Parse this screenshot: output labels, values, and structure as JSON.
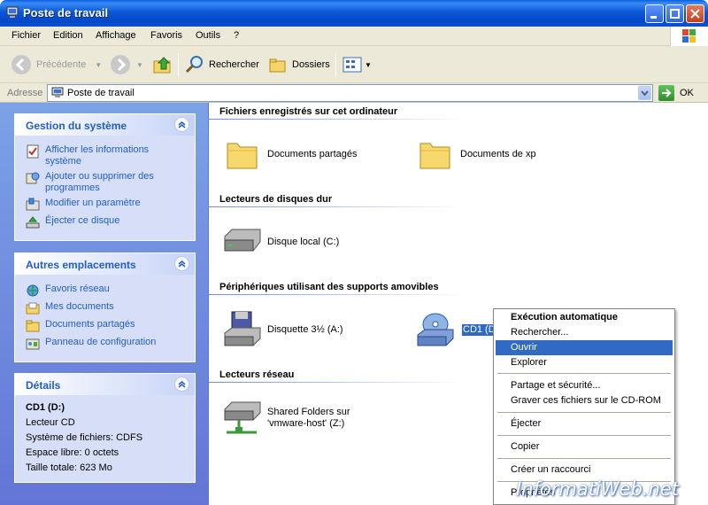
{
  "window": {
    "title": "Poste de travail"
  },
  "menu": [
    "Fichier",
    "Edition",
    "Affichage",
    "Favoris",
    "Outils",
    "?"
  ],
  "toolbar": {
    "back": "Précédente",
    "search": "Rechercher",
    "folders": "Dossiers"
  },
  "address": {
    "label": "Adresse",
    "value": "Poste de travail",
    "go": "OK"
  },
  "sidebar": {
    "system": {
      "title": "Gestion du système",
      "tasks": [
        {
          "label": "Afficher les informations système",
          "icon": "system-info-icon"
        },
        {
          "label": "Ajouter ou supprimer des programmes",
          "icon": "add-remove-programs-icon"
        },
        {
          "label": "Modifier un paramètre",
          "icon": "control-settings-icon"
        },
        {
          "label": "Éjecter ce disque",
          "icon": "eject-disk-icon"
        }
      ]
    },
    "places": {
      "title": "Autres emplacements",
      "items": [
        {
          "label": "Favoris réseau",
          "icon": "network-places-icon"
        },
        {
          "label": "Mes documents",
          "icon": "my-documents-icon"
        },
        {
          "label": "Documents partagés",
          "icon": "shared-folder-icon"
        },
        {
          "label": "Panneau de configuration",
          "icon": "control-panel-icon"
        }
      ]
    },
    "details": {
      "title": "Détails",
      "name": "CD1 (D:)",
      "type": "Lecteur CD",
      "filesystem": "Système de fichiers: CDFS",
      "free": "Espace libre: 0 octets",
      "total": "Taille totale: 623 Mo"
    }
  },
  "groups": [
    {
      "title": "Fichiers enregistrés sur cet ordinateur",
      "items": [
        {
          "label": "Documents partagés",
          "icon": "folder-icon"
        },
        {
          "label": "Documents de xp",
          "icon": "folder-icon"
        }
      ]
    },
    {
      "title": "Lecteurs de disques dur",
      "items": [
        {
          "label": "Disque local (C:)",
          "icon": "hard-disk-icon"
        }
      ]
    },
    {
      "title": "Périphériques utilisant des supports amovibles",
      "items": [
        {
          "label": "Disquette 3½ (A:)",
          "icon": "floppy-drive-icon"
        },
        {
          "label": "CD1 (D",
          "icon": "cd-drive-icon"
        }
      ]
    },
    {
      "title": "Lecteurs réseau",
      "items": [
        {
          "label_lines": [
            "Shared Folders sur",
            "'vmware-host' (Z:)"
          ],
          "icon": "network-drive-icon"
        }
      ]
    }
  ],
  "context_menu": {
    "items": [
      "Exécution automatique",
      "Rechercher...",
      "Ouvrir",
      "Explorer",
      "Partage et sécurité...",
      "Graver ces fichiers sur le CD-ROM",
      "Éjecter",
      "Copier",
      "Créer un raccourci",
      "Propriétés"
    ],
    "highlighted": "Ouvrir"
  },
  "watermark": "InformatiWeb.net",
  "colors": {
    "titlebar": "#0a57d8",
    "sidebar": "#6375d6",
    "selection": "#316ac5",
    "link": "#215dc6"
  }
}
